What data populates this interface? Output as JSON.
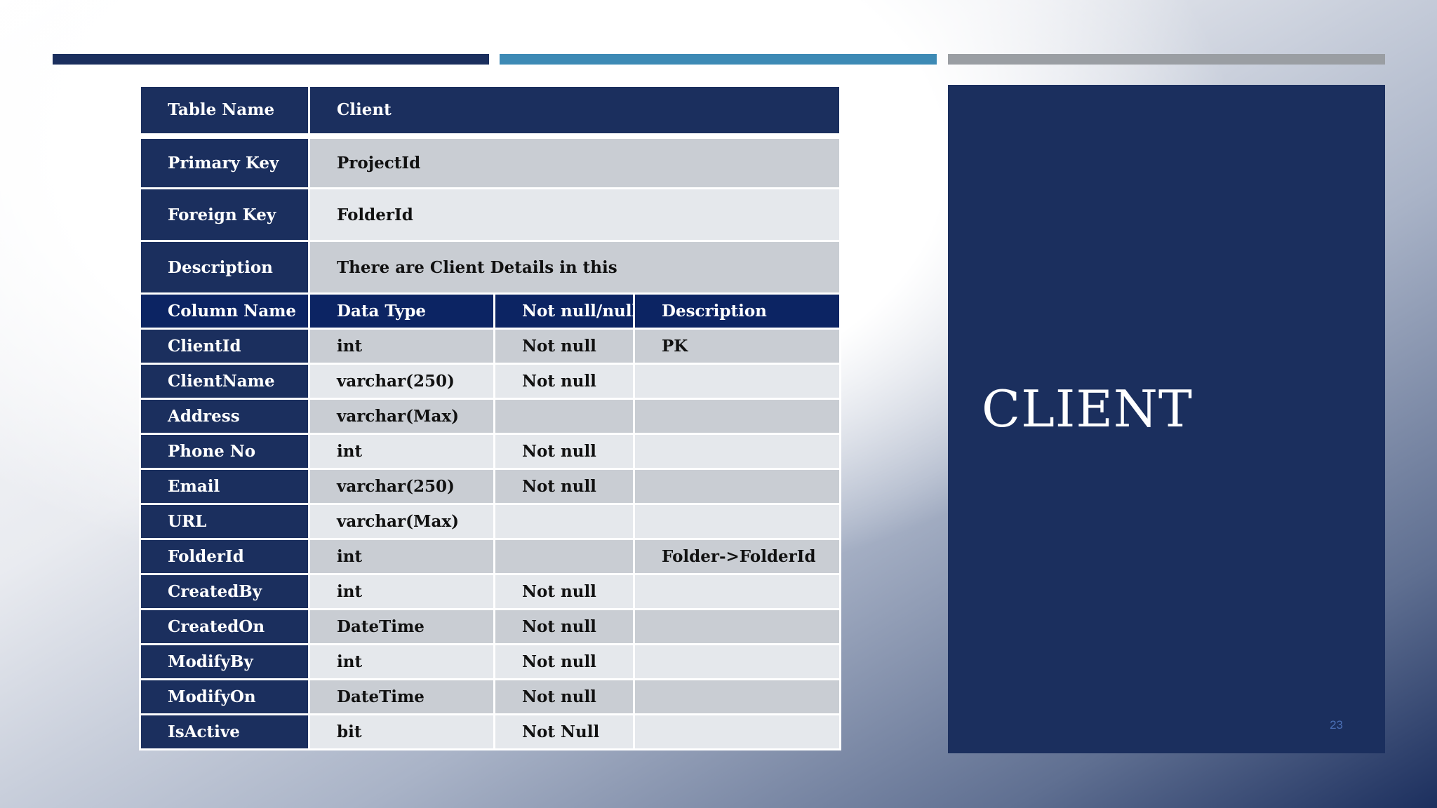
{
  "slide": {
    "title": "CLIENT",
    "page_number": "23",
    "accent_colors": [
      "#1b2f5e",
      "#3d8ab5",
      "#9a9ea3"
    ]
  },
  "meta": {
    "table_name_label": "Table Name",
    "table_name_value": "Client",
    "primary_key_label": "Primary Key",
    "primary_key_value": "ProjectId",
    "foreign_key_label": "Foreign Key",
    "foreign_key_value": "FolderId",
    "description_label": "Description",
    "description_value": "There are Client Details in this"
  },
  "columns_header": {
    "column_name": "Column Name",
    "data_type": "Data Type",
    "nullability": "Not null/null",
    "description": "Description"
  },
  "rows": [
    {
      "name": "ClientId",
      "type": "int",
      "null": "Not null",
      "desc": "PK"
    },
    {
      "name": "ClientName",
      "type": "varchar(250)",
      "null": "Not null",
      "desc": ""
    },
    {
      "name": "Address",
      "type": "varchar(Max)",
      "null": "",
      "desc": ""
    },
    {
      "name": "Phone No",
      "type": "int",
      "null": "Not null",
      "desc": ""
    },
    {
      "name": "Email",
      "type": "varchar(250)",
      "null": "Not null",
      "desc": ""
    },
    {
      "name": "URL",
      "type": "varchar(Max)",
      "null": "",
      "desc": ""
    },
    {
      "name": "FolderId",
      "type": "int",
      "null": "",
      "desc": "Folder->FolderId"
    },
    {
      "name": "CreatedBy",
      "type": "int",
      "null": "Not null",
      "desc": ""
    },
    {
      "name": "CreatedOn",
      "type": "DateTime",
      "null": "Not null",
      "desc": ""
    },
    {
      "name": "ModifyBy",
      "type": "int",
      "null": "Not null",
      "desc": ""
    },
    {
      "name": "ModifyOn",
      "type": "DateTime",
      "null": "Not null",
      "desc": ""
    },
    {
      "name": "IsActive",
      "type": "bit",
      "null": "Not Null",
      "desc": ""
    }
  ]
}
